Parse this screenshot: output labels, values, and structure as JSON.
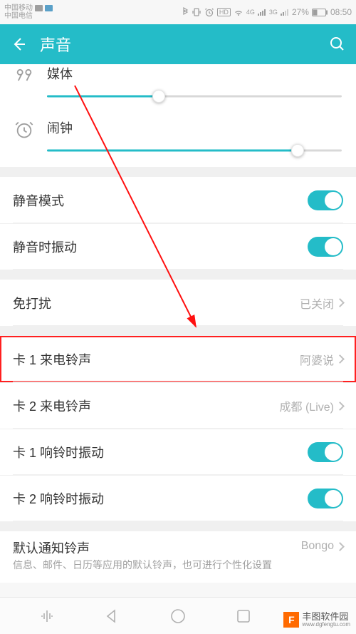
{
  "statusbar": {
    "carrier1": "中国移动",
    "carrier2": "中国电信",
    "hd": "HD",
    "net1": "4G",
    "net2": "3G",
    "battery": "27%",
    "time": "08:50"
  },
  "header": {
    "title": "声音"
  },
  "sliders": {
    "media": {
      "label": "媒体",
      "percent": 38
    },
    "alarm": {
      "label": "闹钟",
      "percent": 85
    }
  },
  "rows": {
    "silent": {
      "label": "静音模式",
      "on": true
    },
    "vibrate_silent": {
      "label": "静音时振动",
      "on": true
    },
    "dnd": {
      "label": "免打扰",
      "value": "已关闭"
    },
    "sim1_ring": {
      "label": "卡 1 来电铃声",
      "value": "阿婆说"
    },
    "sim2_ring": {
      "label": "卡 2 来电铃声",
      "value": "成都 (Live)"
    },
    "sim1_vib": {
      "label": "卡 1 响铃时振动",
      "on": true
    },
    "sim2_vib": {
      "label": "卡 2 响铃时振动",
      "on": true
    },
    "notif": {
      "label": "默认通知铃声",
      "sub": "信息、邮件、日历等应用的默认铃声，也可进行个性化设置",
      "value": "Bongo"
    }
  },
  "watermark": {
    "brand": "丰图软件园",
    "url": "www.dgfengtu.com"
  }
}
